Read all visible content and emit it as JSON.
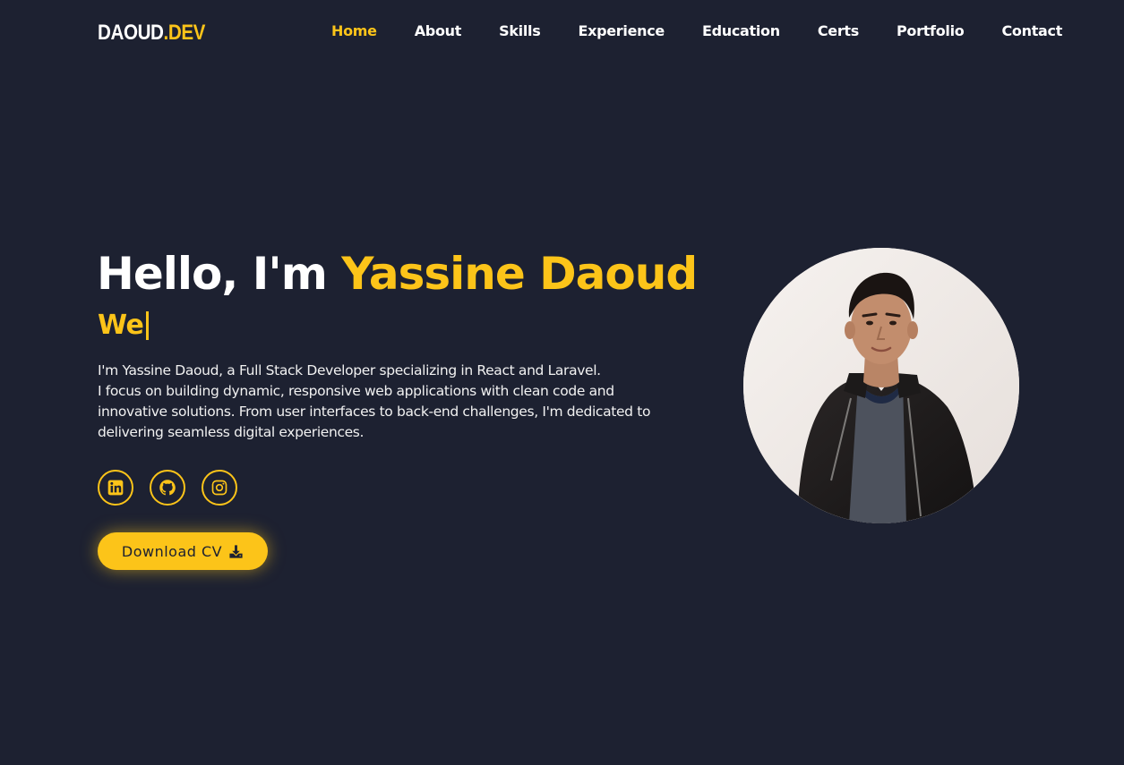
{
  "brand": {
    "logo_main": "DAOUD",
    "logo_dot": ".",
    "logo_accent": "DEV"
  },
  "nav": {
    "items": [
      {
        "label": "Home",
        "active": true
      },
      {
        "label": "About",
        "active": false
      },
      {
        "label": "Skills",
        "active": false
      },
      {
        "label": "Experience",
        "active": false
      },
      {
        "label": "Education",
        "active": false
      },
      {
        "label": "Certs",
        "active": false
      },
      {
        "label": "Portfolio",
        "active": false
      },
      {
        "label": "Contact",
        "active": false
      }
    ]
  },
  "hero": {
    "greeting": "Hello, I'm ",
    "name": "Yassine Daoud",
    "typed_text": "We",
    "bio_lines": [
      "I'm Yassine Daoud, a Full Stack Developer specializing in React and Laravel.",
      "I focus on building dynamic, responsive web applications with clean code and",
      "innovative solutions. From user interfaces to back-end challenges, I'm dedicated to",
      "delivering seamless digital experiences."
    ],
    "socials": [
      {
        "icon": "linkedin-icon"
      },
      {
        "icon": "github-icon"
      },
      {
        "icon": "instagram-icon"
      }
    ],
    "cv_button_label": "Download CV",
    "cv_button_icon": "download-icon"
  },
  "colors": {
    "background": "#1d2131",
    "accent": "#fcc419",
    "text": "#ffffff"
  }
}
